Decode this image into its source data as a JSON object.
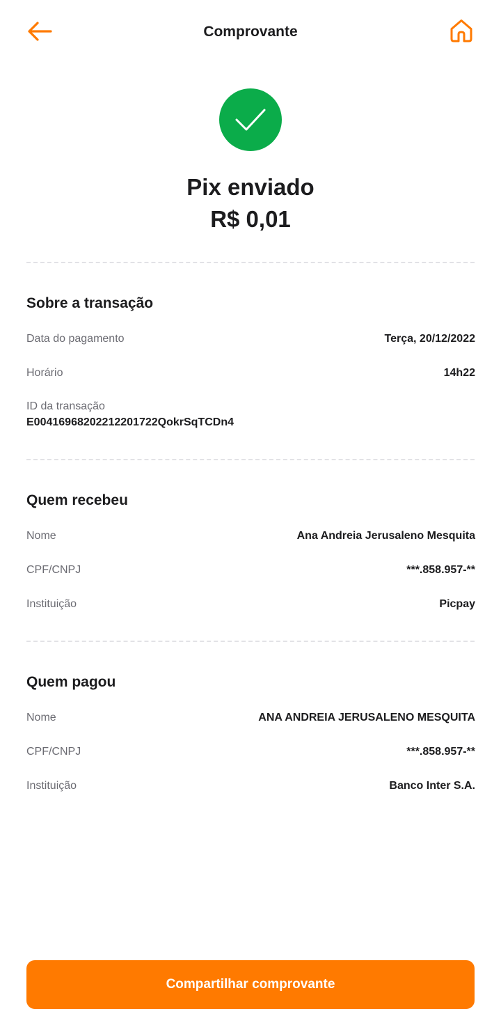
{
  "header": {
    "title": "Comprovante",
    "back_icon": "arrow-left-icon",
    "home_icon": "home-icon"
  },
  "status": {
    "icon": "check-icon",
    "title": "Pix enviado",
    "amount": "R$ 0,01"
  },
  "transaction": {
    "section_title": "Sobre a transação",
    "date_label": "Data do pagamento",
    "date_value": "Terça, 20/12/2022",
    "time_label": "Horário",
    "time_value": "14h22",
    "id_label": "ID da transação",
    "id_value": "E00416968202212201722QokrSqTCDn4"
  },
  "recipient": {
    "section_title": "Quem recebeu",
    "name_label": "Nome",
    "name_value": "Ana Andreia Jerusaleno Mesquita",
    "doc_label": "CPF/CNPJ",
    "doc_value": "***.858.957-**",
    "institution_label": "Instituição",
    "institution_value": "Picpay"
  },
  "payer": {
    "section_title": "Quem pagou",
    "name_label": "Nome",
    "name_value": "ANA ANDREIA JERUSALENO MESQUITA",
    "doc_label": "CPF/CNPJ",
    "doc_value": "***.858.957-**",
    "institution_label": "Instituição",
    "institution_value": "Banco Inter S.A."
  },
  "actions": {
    "share_label": "Compartilhar comprovante"
  },
  "colors": {
    "accent": "#ff7a00",
    "success": "#0bac4a",
    "text": "#1c1c1e",
    "muted": "#6b6b72",
    "divider": "#e2e2e6"
  }
}
